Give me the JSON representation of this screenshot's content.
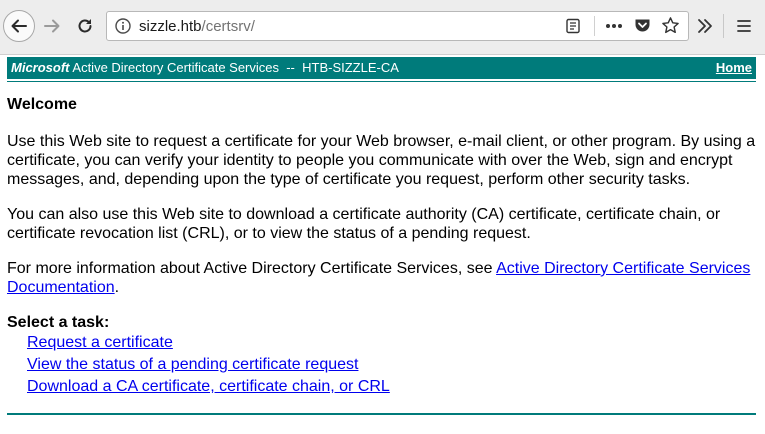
{
  "browser": {
    "url_host": "sizzle.htb",
    "url_path": "/certsrv/"
  },
  "banner": {
    "brand": "Microsoft",
    "title": " Active Directory Certificate Services  --  HTB-SIZZLE-CA",
    "home_label": "Home"
  },
  "content": {
    "heading": "Welcome",
    "paragraph1": "Use this Web site to request a certificate for your Web browser, e-mail client, or other program. By using a certificate, you can verify your identity to people you communicate with over the Web, sign and encrypt messages, and, depending upon the type of certificate you request, perform other security tasks.",
    "paragraph2": "You can also use this Web site to download a certificate authority (CA) certificate, certificate chain, or certificate revocation list (CRL), or to view the status of a pending request.",
    "paragraph3_prefix": "For more information about Active Directory Certificate Services, see ",
    "paragraph3_link": "Active Directory Certificate Services Documentation",
    "paragraph3_suffix": ".",
    "task_heading": "Select a task:",
    "tasks": [
      "Request a certificate",
      "View the status of a pending certificate request",
      "Download a CA certificate, certificate chain, or CRL"
    ]
  }
}
